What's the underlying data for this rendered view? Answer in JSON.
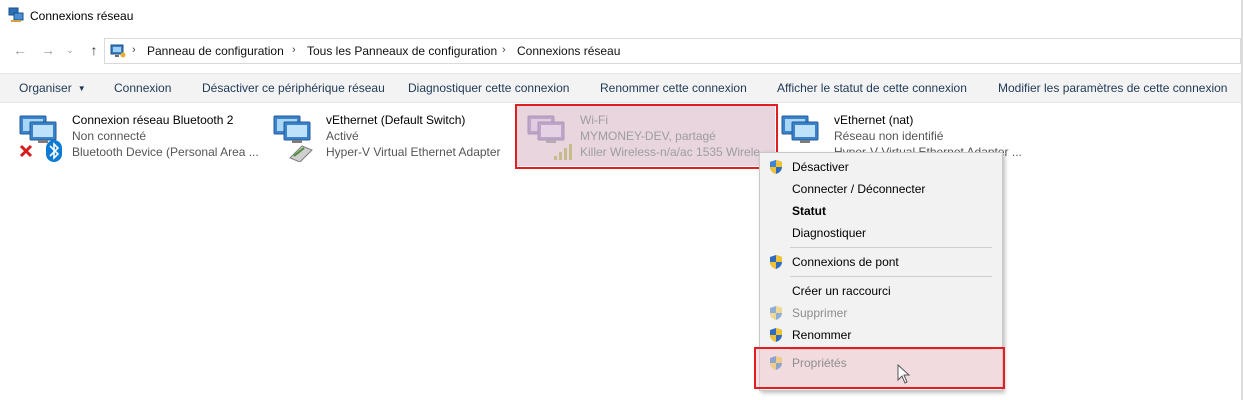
{
  "window": {
    "title": "Connexions réseau",
    "icon": "network-connections-icon"
  },
  "navigation": {
    "back_icon": "arrow-left-icon",
    "forward_icon": "arrow-right-icon",
    "recent_icon": "chevron-down-icon",
    "up_icon": "arrow-up-icon",
    "breadcrumbs": [
      "Panneau de configuration",
      "Tous les Panneaux de configuration",
      "Connexions réseau"
    ],
    "separator": "›"
  },
  "toolbar": {
    "items": [
      "Organiser",
      "Connexion",
      "Désactiver ce périphérique réseau",
      "Diagnostiquer cette connexion",
      "Renommer cette connexion",
      "Afficher le statut de cette connexion",
      "Modifier les paramètres de cette connexion"
    ]
  },
  "connections": [
    {
      "name": "Connexion réseau Bluetooth 2",
      "status": "Non connecté",
      "device": "Bluetooth Device (Personal Area ...",
      "icon": "bluetooth-network-icon",
      "selected": false
    },
    {
      "name": "vEthernet (Default Switch)",
      "status": "Activé",
      "device": "Hyper-V Virtual Ethernet Adapter",
      "icon": "ethernet-adapter-icon",
      "selected": false
    },
    {
      "name": "Wi-Fi",
      "status": "MYMONEY-DEV, partagé",
      "device": "Killer Wireless-n/a/ac 1535 Wirele...",
      "icon": "wifi-adapter-icon",
      "selected": true
    },
    {
      "name": "vEthernet (nat)",
      "status": "Réseau non identifié",
      "device": "Hyper-V Virtual Ethernet Adapter ...",
      "icon": "ethernet-adapter-icon",
      "selected": false
    }
  ],
  "context_menu": {
    "items": [
      {
        "label": "Désactiver",
        "shield": true,
        "bold": false,
        "disabled": false
      },
      {
        "label": "Connecter / Déconnecter",
        "shield": false,
        "bold": false,
        "disabled": false
      },
      {
        "label": "Statut",
        "shield": false,
        "bold": true,
        "disabled": false
      },
      {
        "label": "Diagnostiquer",
        "shield": false,
        "bold": false,
        "disabled": false
      },
      {
        "label": "Connexions de pont",
        "shield": true,
        "bold": false,
        "disabled": false
      },
      {
        "label": "Créer un raccourci",
        "shield": false,
        "bold": false,
        "disabled": false
      },
      {
        "label": "Supprimer",
        "shield": true,
        "bold": false,
        "disabled": true
      },
      {
        "label": "Renommer",
        "shield": true,
        "bold": false,
        "disabled": false
      },
      {
        "label": "Propriétés",
        "shield": true,
        "bold": false,
        "disabled": true
      }
    ]
  },
  "colors": {
    "highlight": "#e02020",
    "toolbar_text": "#1e3956",
    "selection": "#e8d5dd"
  }
}
